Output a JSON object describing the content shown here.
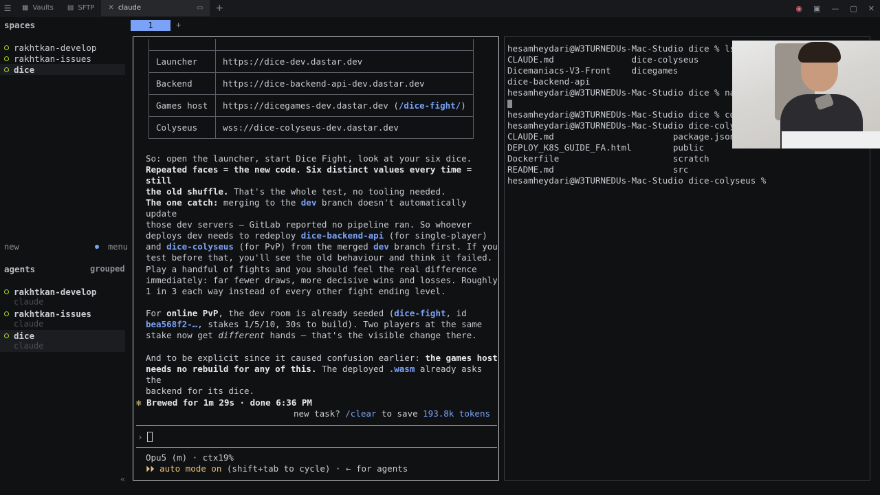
{
  "topbar": {
    "tabs": [
      {
        "label": "Vaults",
        "icon": "vault-icon"
      },
      {
        "label": "SFTP",
        "icon": "folder-icon"
      },
      {
        "label": "claude",
        "icon": "close-icon"
      }
    ],
    "new_tab": "+"
  },
  "sidebar": {
    "spaces_heading": "spaces",
    "spaces": [
      {
        "label": "rakhtkan-develop"
      },
      {
        "label": "rakhtkan-issues"
      },
      {
        "label": "dice"
      }
    ],
    "new_label": "new",
    "menu_label": "menu",
    "agents_heading": "agents",
    "grouped_label": "grouped",
    "agents": [
      {
        "label": "rakhtkan-develop",
        "sub": "claude"
      },
      {
        "label": "rakhtkan-issues",
        "sub": "claude"
      },
      {
        "label": "dice",
        "sub": "claude"
      }
    ],
    "collapse": "«"
  },
  "pane_tabs": {
    "active": "1",
    "add": "+"
  },
  "claude_pane": {
    "table": [
      {
        "key": "Launcher",
        "value": "https://dice-dev.dastar.dev"
      },
      {
        "key": "Backend",
        "value": "https://dice-backend-api-dev.dastar.dev"
      },
      {
        "key": "Games host",
        "value": "https://dicegames-dev.dastar.dev (",
        "value_code": "/dice-fight/",
        "value_end": ")"
      },
      {
        "key": "Colyseus",
        "value": "wss://dice-colyseus-dev.dastar.dev"
      }
    ],
    "p1": {
      "a": "So: open the launcher, start Dice Fight, look at your six dice.\n",
      "b": "Repeated faces = the new code. Six distinct values every time = still\nthe old shuffle.",
      "c": " That's the whole test, no tooling needed."
    },
    "p2": {
      "a": "The one catch:",
      "b": " merging to the ",
      "c": "dev",
      "d": " branch doesn't automatically update\nthose dev servers — GitLab reported no pipeline ran. So whoever\ndeploys dev needs to redeploy ",
      "e": "dice-backend-api",
      "f": " (for single-player)\nand ",
      "g": "dice-colyseus",
      "h": " (for PvP) from the merged ",
      "i": "dev",
      "j": " branch first. If you\ntest before that, you'll see the old behaviour and think it failed."
    },
    "p3": "Play a handful of fights and you should feel the real difference\nimmediately: far fewer draws, more decisive wins and losses. Roughly\n1 in 3 each way instead of every other fight ending level.",
    "p4": {
      "a": "For ",
      "b": "online PvP",
      "c": ", the dev room is already seeded (",
      "d": "dice-fight",
      "e": ", id\n",
      "f": "bea568f2-…",
      "g": ", stakes 1/5/10, 30s to build). Two players at the same\nstake now get ",
      "h": "different",
      "i": " hands — that's the visible change there."
    },
    "p5": {
      "a": "And to be explicit since it caused confusion earlier: ",
      "b": "the games host\nneeds no rebuild for any of this.",
      "c": " The deployed ",
      "d": ".wasm",
      "e": " already asks the\nbackend for its dice."
    },
    "brewed": "Brewed for 1m 29s · done 6:36 PM",
    "brewed_star": "✻",
    "newtask_a": "new task? ",
    "newtask_b": "/clear",
    "newtask_c": " to save ",
    "newtask_d": "193.8k tokens",
    "prompt_symbol": "›",
    "status_model": "Opu5 (m) · ctx19%",
    "status_mode_icon": "⏵⏵",
    "status_mode_a": " auto mode on",
    "status_mode_b": " (shift+tab to cycle) · ← for agents"
  },
  "terminal": {
    "lines": [
      "hesamheydari@W3TURNEDUs-Mac-Studio dice % ls",
      "CLAUDE.md               dice-colyseus",
      "Dicemaniacs-V3-Front    dicegames",
      "dice-backend-api",
      "hesamheydari@W3TURNEDUs-Mac-Studio dice % nar",
      "",
      "hesamheydari@W3TURNEDUs-Mac-Studio dice % cd",
      "hesamheydari@W3TURNEDUs-Mac-Studio dice-colys",
      "CLAUDE.md                       package.json",
      "DEPLOY_K8S_GUIDE_FA.html        public",
      "Dockerfile                      scratch",
      "README.md                       src",
      "hesamheydari@W3TURNEDUs-Mac-Studio dice-colyseus %"
    ]
  }
}
